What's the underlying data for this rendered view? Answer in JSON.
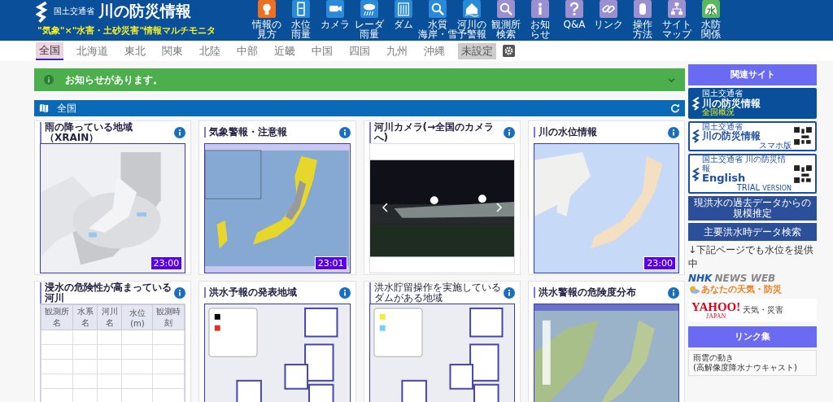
{
  "header": {
    "agency": "国土交通省",
    "title": "川の防災情報",
    "subtitle": "\"気象\"×\"水害・土砂災害\"情報マルチモニタ",
    "nav": [
      {
        "lines": [
          "情報の",
          "見方"
        ],
        "color": "#f07020"
      },
      {
        "lines": [
          "水位",
          "雨量"
        ],
        "color": "#2a8ad8"
      },
      {
        "lines": [
          "カメラ"
        ],
        "color": "#2a8ad8"
      },
      {
        "lines": [
          "レーダ",
          "雨量"
        ],
        "color": "#2a8ad8"
      },
      {
        "lines": [
          "ダム"
        ],
        "color": "#2a8ad8"
      },
      {
        "lines": [
          "水質",
          "海岸・雪"
        ],
        "color": "#2a8ad8"
      },
      {
        "lines": [
          "河川の",
          "予警報"
        ],
        "color": "#2a8ad8"
      },
      {
        "lines": [
          "観測所",
          "検索"
        ],
        "color": "#9c8fd0"
      },
      {
        "lines": [
          "お知",
          "らせ"
        ],
        "color": "#9c8fd0"
      },
      {
        "lines": [
          "Q&A"
        ],
        "color": "#9c8fd0"
      },
      {
        "lines": [
          "リンク"
        ],
        "color": "#9c8fd0"
      },
      {
        "lines": [
          "操作",
          "方法"
        ],
        "color": "#9c8fd0"
      },
      {
        "lines": [
          "サイト",
          "マップ"
        ],
        "color": "#9c8fd0"
      },
      {
        "lines": [
          "水防",
          "関係"
        ],
        "color": "#5cb85c",
        "glyph": "水"
      }
    ]
  },
  "regions": [
    {
      "label": "全国",
      "selected": true,
      "kind": "region"
    },
    {
      "label": "北海道",
      "selected": false,
      "kind": "region"
    },
    {
      "label": "東北",
      "selected": false,
      "kind": "region"
    },
    {
      "label": "関東",
      "selected": false,
      "kind": "region"
    },
    {
      "label": "北陸",
      "selected": false,
      "kind": "region"
    },
    {
      "label": "中部",
      "selected": false,
      "kind": "region"
    },
    {
      "label": "近畿",
      "selected": false,
      "kind": "region"
    },
    {
      "label": "中国",
      "selected": false,
      "kind": "region"
    },
    {
      "label": "四国",
      "selected": false,
      "kind": "region"
    },
    {
      "label": "九州",
      "selected": false,
      "kind": "region"
    },
    {
      "label": "沖縄",
      "selected": false,
      "kind": "region"
    },
    {
      "label": "未設定",
      "selected": false,
      "kind": "unset"
    }
  ],
  "notice": {
    "text": "お知らせがあります。",
    "expanded": false
  },
  "section": {
    "title": "全国"
  },
  "cards": [
    {
      "title": "雨の降っている地域（XRAIN）",
      "timestamp": "23:00"
    },
    {
      "title": "気象警報・注意報",
      "timestamp": "23:01"
    },
    {
      "title": "河川カメラ(→全国のカメラへ)"
    },
    {
      "title": "川の水位情報",
      "timestamp": "23:00"
    },
    {
      "title": "浸水の危険性が高まっている河川",
      "table": {
        "columns": [
          "観測所名",
          "水系名",
          "河川名",
          "水位(m)",
          "観測時刻"
        ]
      }
    },
    {
      "title": "洪水予報の発表地域"
    },
    {
      "title": "洪水貯留操作を実施しているダムがある地域",
      "small": true
    },
    {
      "title": "洪水警報の危険度分布"
    }
  ],
  "sidebar": {
    "related_heading": "関連サイト",
    "banners": [
      {
        "kind": "national",
        "agency": "国土交通省",
        "title": "川の防災情報",
        "caption": "全国概況"
      },
      {
        "kind": "mobile",
        "agency": "国土交通省",
        "title": "川の防災情報",
        "caption": "スマホ版"
      },
      {
        "kind": "english",
        "agency": "国土交通省 川の防災情報",
        "title": "English",
        "caption": "TRIAL",
        "caption2": "VERSION"
      }
    ],
    "buttons": [
      "現洪水の過去データからの規模推定",
      "主要洪水時データ検索"
    ],
    "note": "↓下記ページでも水位を提供中",
    "nhk": {
      "brand": "NHK",
      "service": "NEWS WEB",
      "tagline": "あなたの天気・防災"
    },
    "yahoo": {
      "brand": "YAHOO!",
      "sub": "JAPAN",
      "tagline": "天気・災害"
    },
    "links_heading": "リンク集",
    "links": [
      {
        "lines": [
          "雨雲の動き",
          "(高解像度降水ナウキャスト)"
        ]
      }
    ]
  }
}
